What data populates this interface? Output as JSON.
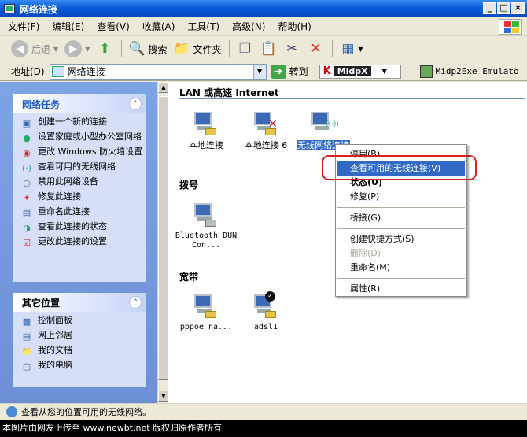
{
  "window": {
    "title": "网络连接",
    "controls": [
      "_",
      "□",
      "×"
    ]
  },
  "menubar": [
    "文件(F)",
    "编辑(E)",
    "查看(V)",
    "收藏(A)",
    "工具(T)",
    "高级(N)",
    "帮助(H)"
  ],
  "toolbar": {
    "back": "后退",
    "search": "搜索",
    "folders": "文件夹"
  },
  "address": {
    "label": "地址(D)",
    "value": "网络连接",
    "go": "转到",
    "midpx": "MidpX",
    "midp2exe": "Midp2Exe Emulato"
  },
  "sidebar": {
    "network_tasks": {
      "title": "网络任务",
      "items": [
        {
          "label": "创建一个新的连接",
          "icon": "new-connection-icon"
        },
        {
          "label": "设置家庭或小型办公室网络",
          "icon": "home-network-icon"
        },
        {
          "label": "更改 Windows 防火墙设置",
          "icon": "firewall-icon"
        },
        {
          "label": "查看可用的无线网络",
          "icon": "wireless-icon"
        },
        {
          "label": "禁用此网络设备",
          "icon": "disable-icon"
        },
        {
          "label": "修复此连接",
          "icon": "repair-icon"
        },
        {
          "label": "重命名此连接",
          "icon": "rename-icon"
        },
        {
          "label": "查看此连接的状态",
          "icon": "status-icon"
        },
        {
          "label": "更改此连接的设置",
          "icon": "settings-icon"
        }
      ]
    },
    "other_places": {
      "title": "其它位置",
      "items": [
        {
          "label": "控制面板",
          "icon": "control-panel-icon"
        },
        {
          "label": "网上邻居",
          "icon": "network-places-icon"
        },
        {
          "label": "我的文档",
          "icon": "documents-icon"
        },
        {
          "label": "我的电脑",
          "icon": "computer-icon"
        }
      ]
    }
  },
  "groups": {
    "lan": "LAN 或高速 Internet",
    "dialup": "拨号",
    "broadband": "宽带"
  },
  "connections": {
    "local1": "本地连接",
    "local6": "本地连接 6",
    "wireless": "无线网络连接",
    "bluetooth": "Bluetooth DUN Con...",
    "pppoe": "pppoe_na...",
    "adsl": "adsl1"
  },
  "context_menu": {
    "items": [
      {
        "label": "停用(B)",
        "style": "normal"
      },
      {
        "label": "查看可用的无线连接(V)",
        "style": "highlight"
      },
      {
        "label": "状态(U)",
        "style": "bold"
      },
      {
        "label": "修复(P)",
        "style": "normal"
      },
      {
        "label": "桥接(G)",
        "style": "normal"
      },
      {
        "label": "创建快捷方式(S)",
        "style": "normal"
      },
      {
        "label": "删除(D)",
        "style": "disabled"
      },
      {
        "label": "重命名(M)",
        "style": "normal"
      },
      {
        "label": "属性(R)",
        "style": "normal"
      }
    ]
  },
  "status": {
    "text": "查看从您的位置可用的无线网络。"
  },
  "caption": "本图片由网友上传至 www.newbt.net 版权归原作者所有",
  "colors": {
    "titlebar": "#0a5fd8",
    "selection": "#316ac5",
    "annotation_oval": "#d62020",
    "sidebar_bg": "#7ca4e5"
  }
}
